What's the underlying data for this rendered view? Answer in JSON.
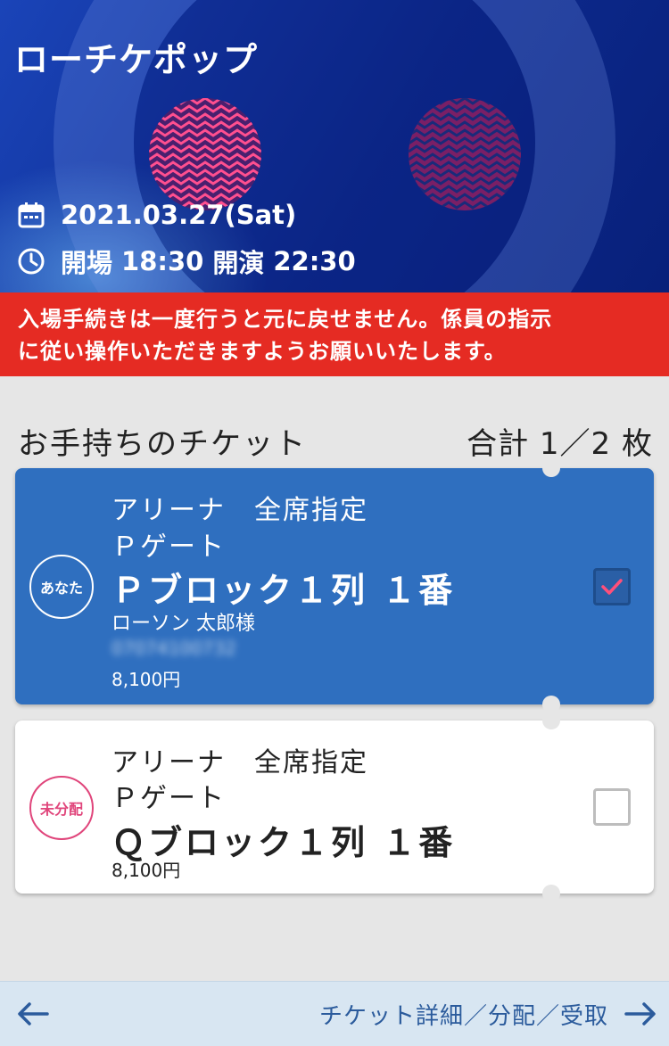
{
  "event": {
    "title": "ローチケポップ",
    "date": "2021.03.27(Sat)",
    "open_label": "開場",
    "open_time": "18:30",
    "start_label": "開演",
    "start_time": "22:30",
    "icons": {
      "date": "calendar-icon",
      "time": "clock-icon"
    }
  },
  "warning": {
    "line1": "入場手続きは一度行うと元に戻せません。係員の指示",
    "line2": "に従い操作いただきますようお願いいたします。"
  },
  "tickets_section": {
    "title": "お手持ちのチケット",
    "count_text": "合計 1／2 枚"
  },
  "tickets": [
    {
      "badge": "あなた",
      "area": "アリーナ　全席指定",
      "gate": "Ｐゲート",
      "seat": "Ｐブロック１列 １番",
      "holder": "ローソン 太郎様",
      "masked_number": "07074100732",
      "price": "8,100円",
      "checked": true
    },
    {
      "badge": "未分配",
      "area": "アリーナ　全席指定",
      "gate": "Ｐゲート",
      "seat": "Ｑブロック１列 １番",
      "price": "8,100円",
      "checked": false
    }
  ],
  "bottom_bar": {
    "forward_label": "チケット詳細／分配／受取"
  },
  "colors": {
    "hero_blue": "#0d2a8e",
    "warning_red": "#e52b23",
    "selected_ticket": "#2f6fbf",
    "badge_pink": "#e0457b",
    "link_blue": "#2b5b9c"
  }
}
